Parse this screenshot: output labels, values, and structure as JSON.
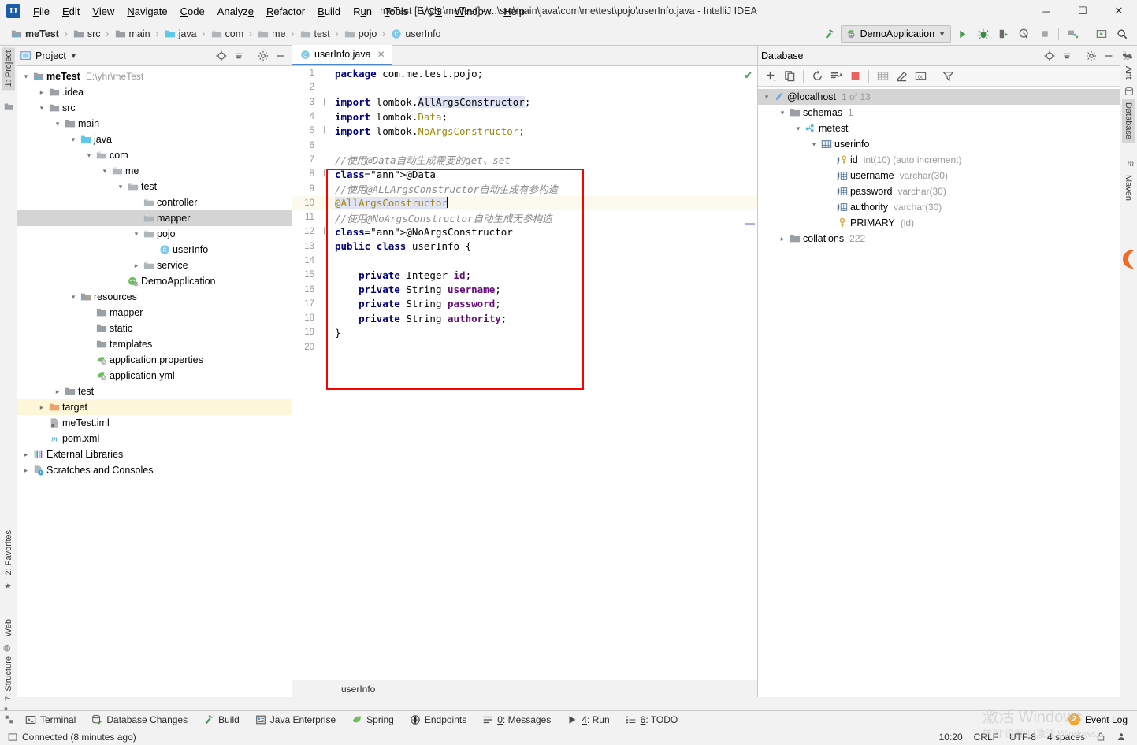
{
  "window": {
    "title": "meTest [E:\\yhr\\meTest] - ...\\src\\main\\java\\com\\me\\test\\pojo\\userInfo.java - IntelliJ IDEA",
    "minimize_label": "─",
    "maximize_label": "☐",
    "close_label": "✕"
  },
  "menu": [
    {
      "label": "File"
    },
    {
      "label": "Edit"
    },
    {
      "label": "View"
    },
    {
      "label": "Navigate"
    },
    {
      "label": "Code"
    },
    {
      "label": "Analyze"
    },
    {
      "label": "Refactor"
    },
    {
      "label": "Build"
    },
    {
      "label": "Run"
    },
    {
      "label": "Tools"
    },
    {
      "label": "VCS"
    },
    {
      "label": "Window"
    },
    {
      "label": "Help"
    }
  ],
  "breadcrumb": [
    {
      "label": "meTest",
      "icon": "module-icon",
      "bold": true
    },
    {
      "label": "src",
      "icon": "folder-icon",
      "bold": false
    },
    {
      "label": "main",
      "icon": "folder-icon",
      "bold": false
    },
    {
      "label": "java",
      "icon": "source-folder-icon",
      "bold": false
    },
    {
      "label": "com",
      "icon": "package-icon",
      "bold": false
    },
    {
      "label": "me",
      "icon": "package-icon",
      "bold": false
    },
    {
      "label": "test",
      "icon": "package-icon",
      "bold": false
    },
    {
      "label": "pojo",
      "icon": "package-icon",
      "bold": false
    },
    {
      "label": "userInfo",
      "icon": "class-icon",
      "bold": false
    }
  ],
  "toolbar": {
    "run_config": "DemoApplication",
    "buttons": [
      {
        "name": "run-button",
        "title": "Run"
      },
      {
        "name": "debug-button",
        "title": "Debug"
      },
      {
        "name": "run-with-coverage-button",
        "title": "Run with Coverage"
      },
      {
        "name": "profile-button",
        "title": "Profile"
      },
      {
        "name": "stop-button",
        "title": "Stop"
      },
      {
        "name": "project-structure-button",
        "title": "Project Structure"
      },
      {
        "name": "update-button",
        "title": "Update"
      },
      {
        "name": "search-everywhere-button",
        "title": "Search Everywhere"
      }
    ]
  },
  "left_strip": [
    {
      "label": "1: Project",
      "active": true
    },
    {
      "label": "2: Favorites",
      "active": false
    },
    {
      "label": "Web",
      "active": false
    },
    {
      "label": "7: Structure",
      "active": false
    }
  ],
  "right_strip": [
    {
      "label": "Ant",
      "active": false
    },
    {
      "label": "Database",
      "active": true
    },
    {
      "label": "Maven",
      "active": false
    }
  ],
  "project_panel": {
    "title": "Project",
    "tree": [
      {
        "indent": 0,
        "arrow": "down",
        "icon": "module-icon",
        "label": "meTest",
        "sub": "E:\\yhr\\meTest",
        "bold": true,
        "state": ""
      },
      {
        "indent": 1,
        "arrow": "right",
        "icon": "folder-icon",
        "label": ".idea",
        "sub": "",
        "bold": false,
        "state": ""
      },
      {
        "indent": 1,
        "arrow": "down",
        "icon": "folder-icon",
        "label": "src",
        "sub": "",
        "bold": false,
        "state": ""
      },
      {
        "indent": 2,
        "arrow": "down",
        "icon": "folder-icon",
        "label": "main",
        "sub": "",
        "bold": false,
        "state": ""
      },
      {
        "indent": 3,
        "arrow": "down",
        "icon": "source-folder-icon",
        "label": "java",
        "sub": "",
        "bold": false,
        "state": ""
      },
      {
        "indent": 4,
        "arrow": "down",
        "icon": "package-icon",
        "label": "com",
        "sub": "",
        "bold": false,
        "state": ""
      },
      {
        "indent": 5,
        "arrow": "down",
        "icon": "package-icon",
        "label": "me",
        "sub": "",
        "bold": false,
        "state": ""
      },
      {
        "indent": 6,
        "arrow": "down",
        "icon": "package-icon",
        "label": "test",
        "sub": "",
        "bold": false,
        "state": ""
      },
      {
        "indent": 7,
        "arrow": "none",
        "icon": "package-icon",
        "label": "controller",
        "sub": "",
        "bold": false,
        "state": ""
      },
      {
        "indent": 7,
        "arrow": "none",
        "icon": "package-icon",
        "label": "mapper",
        "sub": "",
        "bold": false,
        "state": "sel"
      },
      {
        "indent": 7,
        "arrow": "down",
        "icon": "package-icon",
        "label": "pojo",
        "sub": "",
        "bold": false,
        "state": ""
      },
      {
        "indent": 8,
        "arrow": "none",
        "icon": "class-icon",
        "label": "userInfo",
        "sub": "",
        "bold": false,
        "state": ""
      },
      {
        "indent": 7,
        "arrow": "right",
        "icon": "package-icon",
        "label": "service",
        "sub": "",
        "bold": false,
        "state": ""
      },
      {
        "indent": 6,
        "arrow": "none",
        "icon": "spring-class-icon",
        "label": "DemoApplication",
        "sub": "",
        "bold": false,
        "state": ""
      },
      {
        "indent": 3,
        "arrow": "down",
        "icon": "resource-folder-icon",
        "label": "resources",
        "sub": "",
        "bold": false,
        "state": ""
      },
      {
        "indent": 4,
        "arrow": "none",
        "icon": "folder-icon",
        "label": "mapper",
        "sub": "",
        "bold": false,
        "state": ""
      },
      {
        "indent": 4,
        "arrow": "none",
        "icon": "folder-icon",
        "label": "static",
        "sub": "",
        "bold": false,
        "state": ""
      },
      {
        "indent": 4,
        "arrow": "none",
        "icon": "folder-icon",
        "label": "templates",
        "sub": "",
        "bold": false,
        "state": ""
      },
      {
        "indent": 4,
        "arrow": "none",
        "icon": "spring-file-icon",
        "label": "application.properties",
        "sub": "",
        "bold": false,
        "state": ""
      },
      {
        "indent": 4,
        "arrow": "none",
        "icon": "spring-file-icon",
        "label": "application.yml",
        "sub": "",
        "bold": false,
        "state": ""
      },
      {
        "indent": 2,
        "arrow": "right",
        "icon": "folder-icon",
        "label": "test",
        "sub": "",
        "bold": false,
        "state": ""
      },
      {
        "indent": 1,
        "arrow": "right",
        "icon": "target-folder-icon",
        "label": "target",
        "sub": "",
        "bold": false,
        "state": "hl"
      },
      {
        "indent": 1,
        "arrow": "none",
        "icon": "iml-icon",
        "label": "meTest.iml",
        "sub": "",
        "bold": false,
        "state": ""
      },
      {
        "indent": 1,
        "arrow": "none",
        "icon": "maven-icon",
        "label": "pom.xml",
        "sub": "",
        "bold": false,
        "state": ""
      },
      {
        "indent": 0,
        "arrow": "right",
        "icon": "libraries-icon",
        "label": "External Libraries",
        "sub": "",
        "bold": false,
        "state": ""
      },
      {
        "indent": 0,
        "arrow": "right",
        "icon": "scratches-icon",
        "label": "Scratches and Consoles",
        "sub": "",
        "bold": false,
        "state": ""
      }
    ]
  },
  "editor": {
    "tab": {
      "label": "userInfo.java",
      "icon": "class-icon",
      "close": "✕"
    },
    "breadcrumb_bottom": "userInfo",
    "highlight_line": 10,
    "lines": [
      {
        "n": 1,
        "fold": "",
        "text": "package com.me.test.pojo;"
      },
      {
        "n": 2,
        "fold": "",
        "text": ""
      },
      {
        "n": 3,
        "fold": "⌈",
        "text": "import lombok.AllArgsConstructor;"
      },
      {
        "n": 4,
        "fold": "",
        "text": "import lombok.Data;"
      },
      {
        "n": 5,
        "fold": "⌊",
        "text": "import lombok.NoArgsConstructor;"
      },
      {
        "n": 6,
        "fold": "",
        "text": ""
      },
      {
        "n": 7,
        "fold": "",
        "text": "//使用@Data自动生成需要的get、set"
      },
      {
        "n": 8,
        "fold": "⌈",
        "text": "@Data"
      },
      {
        "n": 9,
        "fold": "",
        "text": "//使用@ALLArgsConstructor自动生成有参构造"
      },
      {
        "n": 10,
        "fold": "",
        "text": "@AllArgsConstructor"
      },
      {
        "n": 11,
        "fold": "",
        "text": "//使用@NoArgsConstructor自动生成无参构造"
      },
      {
        "n": 12,
        "fold": "⌊",
        "text": "@NoArgsConstructor"
      },
      {
        "n": 13,
        "fold": "",
        "text": "public class userInfo {"
      },
      {
        "n": 14,
        "fold": "",
        "text": ""
      },
      {
        "n": 15,
        "fold": "",
        "text": "    private Integer id;"
      },
      {
        "n": 16,
        "fold": "",
        "text": "    private String username;"
      },
      {
        "n": 17,
        "fold": "",
        "text": "    private String password;"
      },
      {
        "n": 18,
        "fold": "",
        "text": "    private String authority;"
      },
      {
        "n": 19,
        "fold": "",
        "text": "}"
      },
      {
        "n": 20,
        "fold": "",
        "text": ""
      }
    ]
  },
  "database_panel": {
    "title": "Database",
    "toolbar": [
      {
        "name": "add-button",
        "glyph": "+"
      },
      {
        "name": "duplicate-button",
        "glyph": "❐"
      },
      {
        "name": "refresh-button",
        "glyph": "↻"
      },
      {
        "name": "run-query-button",
        "glyph": "≣"
      },
      {
        "name": "stop-button",
        "glyph": "■"
      },
      {
        "name": "data-editor-button",
        "glyph": "▦"
      },
      {
        "name": "modify-button",
        "glyph": "╱"
      },
      {
        "name": "query-console-button",
        "glyph": "QL"
      },
      {
        "name": "filter-button",
        "glyph": "▽"
      }
    ],
    "tree": [
      {
        "indent": 0,
        "arrow": "down",
        "icon": "datasource-icon",
        "label": "@localhost",
        "sub": "1 of 13",
        "state": "sel"
      },
      {
        "indent": 1,
        "arrow": "down",
        "icon": "folder-icon",
        "label": "schemas",
        "sub": "1",
        "state": ""
      },
      {
        "indent": 2,
        "arrow": "down",
        "icon": "schema-icon",
        "label": "metest",
        "sub": "",
        "state": ""
      },
      {
        "indent": 3,
        "arrow": "down",
        "icon": "table-icon",
        "label": "userinfo",
        "sub": "",
        "state": ""
      },
      {
        "indent": 4,
        "arrow": "none",
        "icon": "key-column-icon",
        "label": "id",
        "sub": "int(10) (auto increment)",
        "state": ""
      },
      {
        "indent": 4,
        "arrow": "none",
        "icon": "column-icon",
        "label": "username",
        "sub": "varchar(30)",
        "state": ""
      },
      {
        "indent": 4,
        "arrow": "none",
        "icon": "column-icon",
        "label": "password",
        "sub": "varchar(30)",
        "state": ""
      },
      {
        "indent": 4,
        "arrow": "none",
        "icon": "column-icon",
        "label": "authority",
        "sub": "varchar(30)",
        "state": ""
      },
      {
        "indent": 4,
        "arrow": "none",
        "icon": "key-icon",
        "label": "PRIMARY",
        "sub": "(id)",
        "state": ""
      },
      {
        "indent": 1,
        "arrow": "right",
        "icon": "folder-icon",
        "label": "collations",
        "sub": "222",
        "state": ""
      }
    ]
  },
  "bottom_tool_window_bar": [
    {
      "label": "Terminal",
      "icon": "terminal-icon",
      "mnemonic": ""
    },
    {
      "label": "Database Changes",
      "icon": "database-changes-icon",
      "mnemonic": ""
    },
    {
      "label": "Build",
      "icon": "build-icon",
      "mnemonic": ""
    },
    {
      "label": "Java Enterprise",
      "icon": "java-enterprise-icon",
      "mnemonic": ""
    },
    {
      "label": "Spring",
      "icon": "spring-icon",
      "mnemonic": ""
    },
    {
      "label": "Endpoints",
      "icon": "endpoints-icon",
      "mnemonic": ""
    },
    {
      "label": "0: Messages",
      "icon": "messages-icon",
      "mnemonic": "0"
    },
    {
      "label": "4: Run",
      "icon": "run-icon",
      "mnemonic": "4"
    },
    {
      "label": "6: TODO",
      "icon": "todo-icon",
      "mnemonic": "6"
    }
  ],
  "status_bar": {
    "message": "Connected (8 minutes ago)",
    "event_log": "Event Log",
    "event_log_count": "2",
    "time": "10:20",
    "line_separator": "CRLF",
    "encoding": "UTF-8",
    "indent": "4 spaces"
  },
  "watermark": {
    "line1": "激活 Windows",
    "line2": "转到“设置”以激活 Windows。"
  },
  "colors": {
    "accent": "#4a86c8",
    "red_highlight": "#ff0000",
    "selection": "#d4d4d4",
    "yellow_highlight": "#fdf6d8",
    "green_ok": "#59a869"
  }
}
